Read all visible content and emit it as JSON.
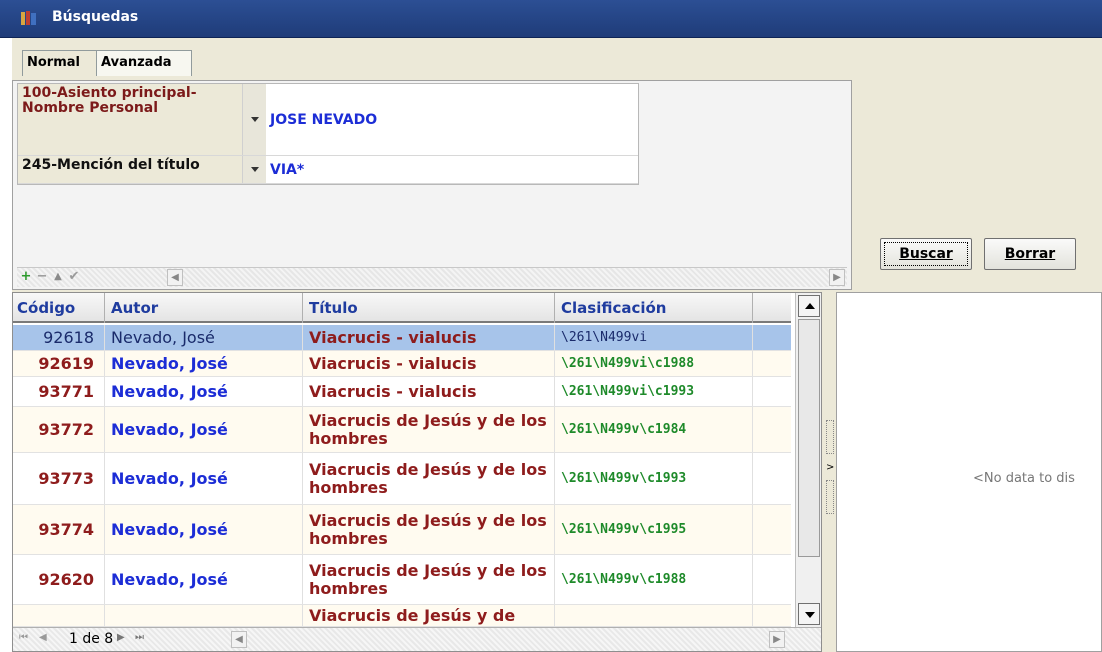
{
  "window": {
    "title": "Búsquedas"
  },
  "tabs": [
    {
      "label": "Normal"
    },
    {
      "label": "Avanzada"
    }
  ],
  "criteria": [
    {
      "field": "100-Asiento principal-Nombre Personal",
      "value": "JOSE NEVADO"
    },
    {
      "field": "245-Mención del título",
      "value": "VIA*"
    }
  ],
  "toolbar": {
    "add": "+",
    "remove": "−",
    "up": "▲",
    "ok": "✔"
  },
  "buttons": {
    "search": "Buscar",
    "clear": "Borrar"
  },
  "grid": {
    "headers": [
      "Código",
      "Autor",
      "Título",
      "Clasificación"
    ],
    "rows": [
      {
        "codigo": "92618",
        "autor": "Nevado, José",
        "titulo": "Viacrucis - vialucis",
        "clasificacion": "\\261\\N499vi"
      },
      {
        "codigo": "92619",
        "autor": "Nevado, José",
        "titulo": "Viacrucis - vialucis",
        "clasificacion": "\\261\\N499vi\\c1988"
      },
      {
        "codigo": "93771",
        "autor": "Nevado, José",
        "titulo": "Viacrucis - vialucis",
        "clasificacion": "\\261\\N499vi\\c1993"
      },
      {
        "codigo": "93772",
        "autor": "Nevado, José",
        "titulo": "Viacrucis de Jesús y de los hombres",
        "clasificacion": "\\261\\N499v\\c1984"
      },
      {
        "codigo": "93773",
        "autor": "Nevado, José",
        "titulo": "Viacrucis de Jesús y de los hombres",
        "clasificacion": "\\261\\N499v\\c1993"
      },
      {
        "codigo": "93774",
        "autor": "Nevado, José",
        "titulo": "Viacrucis de Jesús y de los hombres",
        "clasificacion": "\\261\\N499v\\c1995"
      },
      {
        "codigo": "92620",
        "autor": "Nevado, José",
        "titulo": "Viacrucis de Jesús y de los hombres",
        "clasificacion": "\\261\\N499v\\c1988"
      },
      {
        "codigo": "",
        "autor": "",
        "titulo": "Viacrucis de Jesús y de",
        "clasificacion": ""
      }
    ]
  },
  "pager": {
    "info": "1 de 8"
  },
  "detail": {
    "empty_text": "<No data to dis"
  }
}
